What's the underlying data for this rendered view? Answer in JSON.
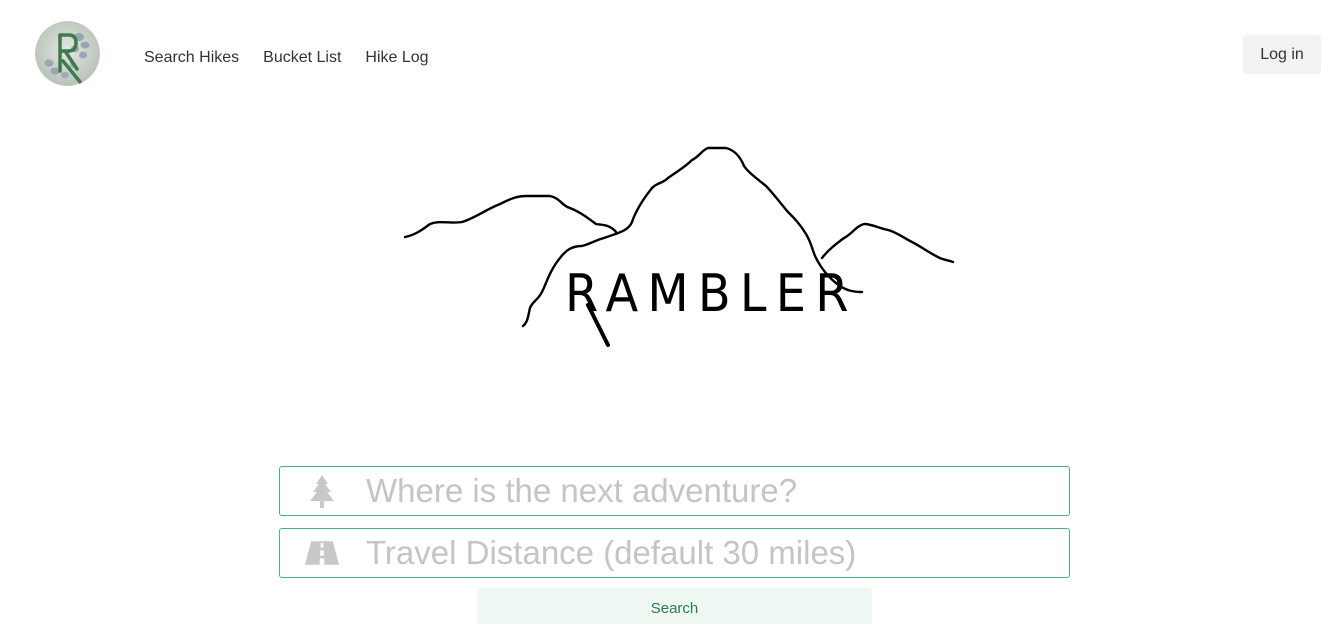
{
  "brand": {
    "logo_letter": "R",
    "wordmark": "RAMBLER"
  },
  "nav": {
    "items": [
      {
        "label": "Search Hikes"
      },
      {
        "label": "Bucket List"
      },
      {
        "label": "Hike Log"
      }
    ]
  },
  "header": {
    "login_label": "Log in"
  },
  "search": {
    "location_placeholder": "Where is the next adventure?",
    "location_icon": "tree-icon",
    "distance_placeholder": "Travel Distance (default 30 miles)",
    "distance_icon": "road-icon",
    "submit_label": "Search"
  },
  "colors": {
    "accent": "#4cb27a",
    "button_bg": "#eef7f1",
    "button_text": "#2e7d4f",
    "icon_gray": "#c8c8c8"
  }
}
